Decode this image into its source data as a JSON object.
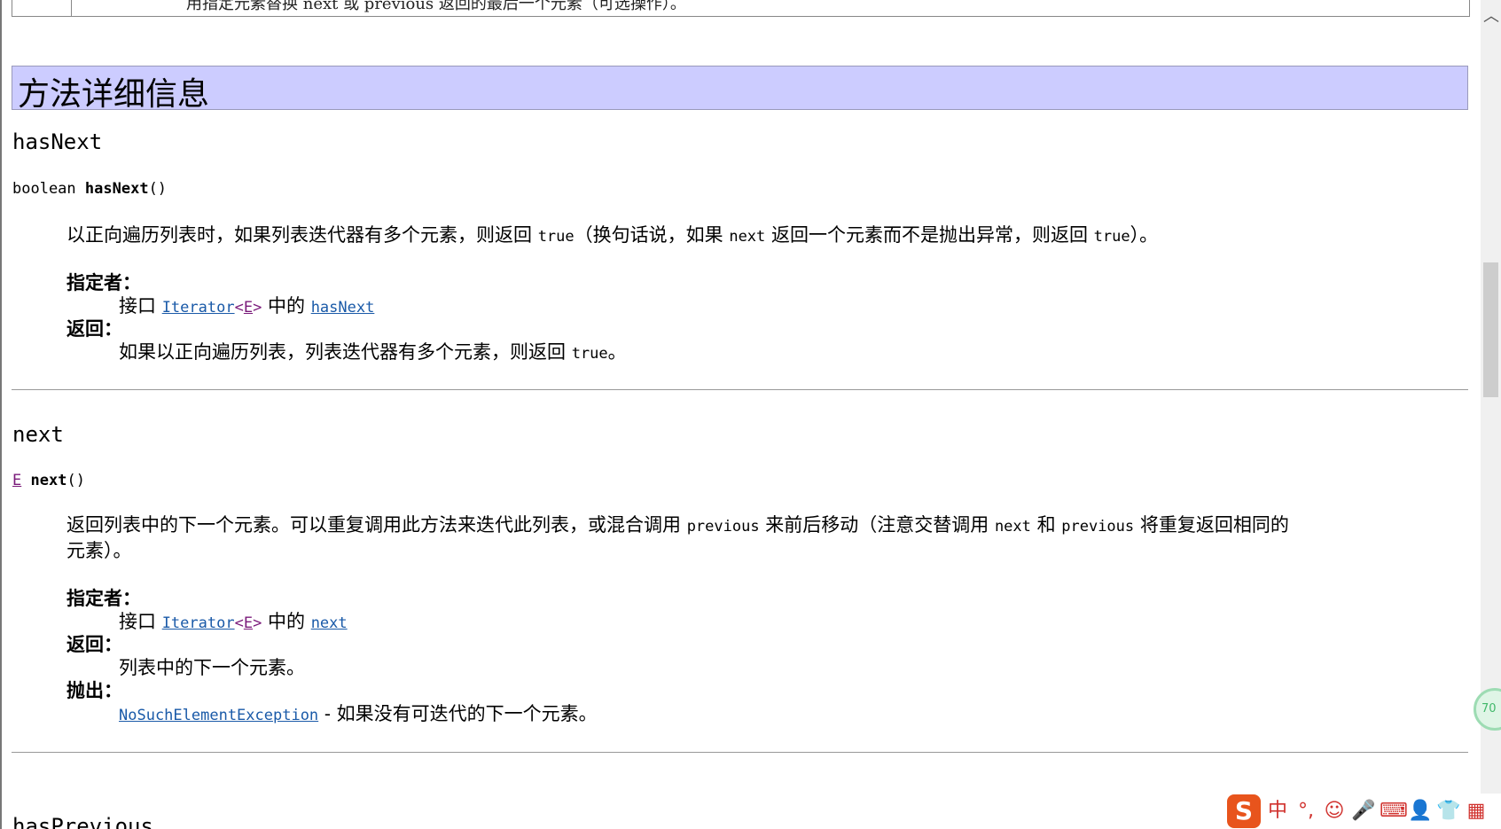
{
  "top_row": {
    "text": "用指定元素替换 next 或 previous 返回的最后一个元素（可选操作）。"
  },
  "section_title": "方法详细信息",
  "methods": [
    {
      "name": "hasNext",
      "sig_type": "boolean",
      "sig_name": "hasNext",
      "sig_params": "()",
      "desc_parts": [
        "以正向遍历列表时，如果列表迭代器有多个元素，则返回 ",
        "true",
        "（换句话说，如果 ",
        "next",
        " 返回一个元素而不是抛出异常，则返回 ",
        "true",
        "）。"
      ],
      "specified_by_label": "指定者：",
      "spec_prefix": "接口 ",
      "spec_iface": "Iterator",
      "spec_type_param": "E",
      "spec_mid": " 中的 ",
      "spec_method": "hasNext",
      "returns_label": "返回：",
      "returns_parts": [
        "如果以正向遍历列表，列表迭代器有多个元素，则返回 ",
        "true",
        "。"
      ]
    },
    {
      "name": "next",
      "sig_type": "E",
      "sig_name": "next",
      "sig_params": "()",
      "desc_line1": [
        "返回列表中的下一个元素。可以重复调用此方法来迭代此列表，或混合调用 ",
        "previous",
        " 来前后移动（注意交替调用 ",
        "next",
        " 和 ",
        "previous",
        " 将重复返回相同的"
      ],
      "desc_line2": "元素）。",
      "specified_by_label": "指定者：",
      "spec_prefix": "接口 ",
      "spec_iface": "Iterator",
      "spec_type_param": "E",
      "spec_mid": " 中的 ",
      "spec_method": "next",
      "returns_label": "返回：",
      "returns_text": "列表中的下一个元素。",
      "throws_label": "抛出：",
      "throws_exception": "NoSuchElementException",
      "throws_text": " - 如果没有可迭代的下一个元素。"
    }
  ],
  "next_method_partial": "hasPrevious",
  "float_ball_text": "70",
  "ime": {
    "logo": "S",
    "items": [
      {
        "icon": "chinese-mode-icon",
        "glyph": "中"
      },
      {
        "icon": "punctuation-icon",
        "glyph": "°,"
      },
      {
        "icon": "emoji-icon",
        "glyph": "☺"
      },
      {
        "icon": "microphone-icon",
        "glyph": "🎤"
      },
      {
        "icon": "keyboard-icon",
        "glyph": "⌨"
      },
      {
        "icon": "user-icon",
        "glyph": "👤"
      },
      {
        "icon": "skin-icon",
        "glyph": "👕"
      },
      {
        "icon": "grid-menu-icon",
        "glyph": "▦"
      }
    ]
  },
  "colors": {
    "header_bg": "#ccccff",
    "link": "#1a5aa8",
    "type_link": "#7a1a7a",
    "ime_red": "#d0312d"
  }
}
